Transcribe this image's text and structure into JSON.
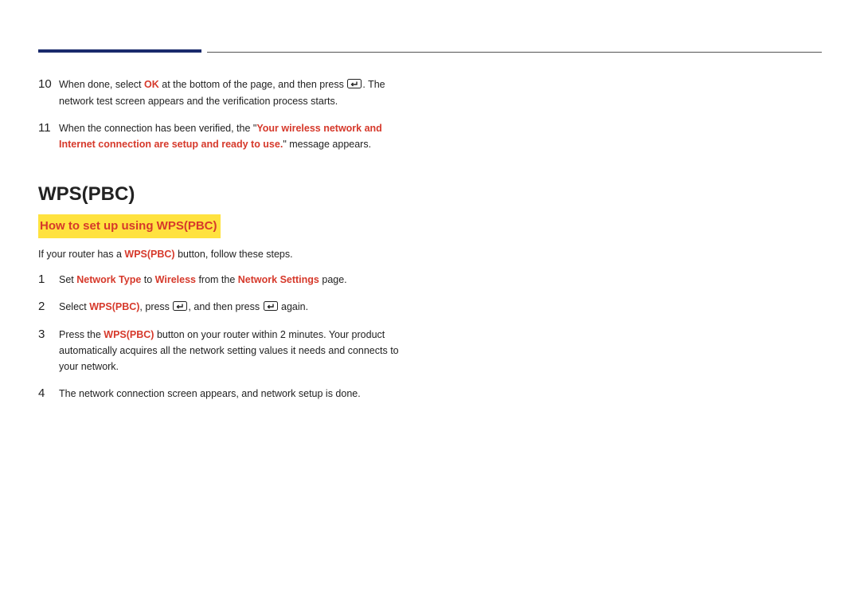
{
  "step10": {
    "num": "10",
    "t1": "When done, select ",
    "ok": "OK",
    "t2": " at the bottom of the page, and then press ",
    "t3": ". The network test screen appears and the verification process starts."
  },
  "step11": {
    "num": "11",
    "t1": "When the connection has been verified, the \"",
    "msg": "Your wireless network and Internet connection are setup and ready to use.",
    "t2": "\" message appears."
  },
  "section_title": "WPS(PBC)",
  "sub_title": "How to set up using WPS(PBC)",
  "intro": {
    "t1": "If your router has a ",
    "k": "WPS(PBC)",
    "t2": " button, follow these steps."
  },
  "s1": {
    "num": "1",
    "t1": "Set ",
    "k1": "Network Type",
    "t2": " to ",
    "k2": "Wireless",
    "t3": " from the ",
    "k3": "Network Settings",
    "t4": " page."
  },
  "s2": {
    "num": "2",
    "t1": "Select ",
    "k": "WPS(PBC)",
    "t2": ", press ",
    "t3": ", and then press ",
    "t4": " again."
  },
  "s3": {
    "num": "3",
    "t1": "Press the ",
    "k": "WPS(PBC)",
    "t2": " button on your router within 2 minutes. Your product automatically acquires all the network setting values it needs and connects to your network."
  },
  "s4": {
    "num": "4",
    "t1": "The network connection screen appears, and network setup is done."
  }
}
